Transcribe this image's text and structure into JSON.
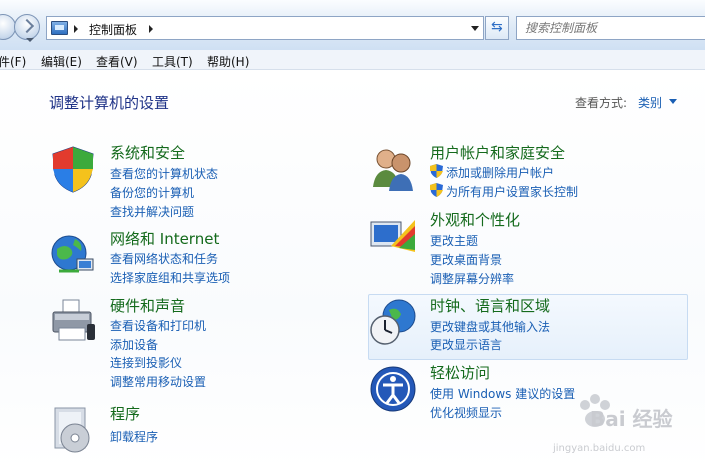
{
  "address_bar": {
    "breadcrumb": "控制面板",
    "search_placeholder": "搜索控制面板"
  },
  "menu": {
    "items": [
      "件(F)",
      "编辑(E)",
      "查看(V)",
      "工具(T)",
      "帮助(H)"
    ]
  },
  "page": {
    "title": "调整计算机的设置",
    "view_label": "查看方式:",
    "view_value": "类别"
  },
  "categories": {
    "security": {
      "title": "系统和安全",
      "icon": "shield-icon",
      "links": [
        "查看您的计算机状态",
        "备份您的计算机",
        "查找并解决问题"
      ]
    },
    "network": {
      "title": "网络和 Internet",
      "icon": "globe-network-icon",
      "links": [
        "查看网络状态和任务",
        "选择家庭组和共享选项"
      ]
    },
    "hardware": {
      "title": "硬件和声音",
      "icon": "printer-icon",
      "links": [
        "查看设备和打印机",
        "添加设备",
        "连接到投影仪",
        "调整常用移动设置"
      ]
    },
    "programs": {
      "title": "程序",
      "icon": "programs-icon",
      "links": [
        "卸载程序"
      ]
    },
    "users": {
      "title": "用户帐户和家庭安全",
      "icon": "users-icon",
      "links": [
        "添加或删除用户帐户",
        "为所有用户设置家长控制"
      ]
    },
    "appearance": {
      "title": "外观和个性化",
      "icon": "appearance-icon",
      "links": [
        "更改主题",
        "更改桌面背景",
        "调整屏幕分辨率"
      ]
    },
    "clock": {
      "title": "时钟、语言和区域",
      "icon": "clock-globe-icon",
      "links": [
        "更改键盘或其他输入法",
        "更改显示语言"
      ]
    },
    "access": {
      "title": "轻松访问",
      "icon": "ease-of-access-icon",
      "links": [
        "使用 Windows 建议的设置",
        "优化视频显示"
      ]
    }
  },
  "watermark": {
    "brand": "Bai 经验",
    "url": "jingyan.baidu.com"
  },
  "colors": {
    "category_title": "#146a1c",
    "link": "#1a5fb4",
    "page_title": "#1e3287"
  }
}
